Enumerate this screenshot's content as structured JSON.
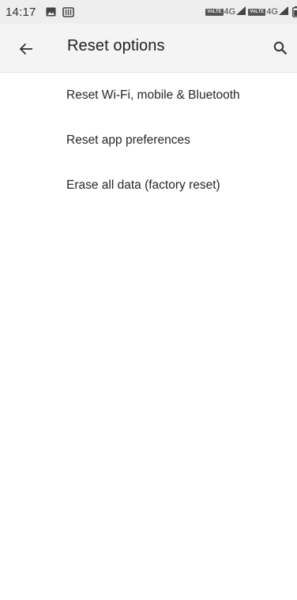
{
  "status_bar": {
    "time": "14:17",
    "icons_left": [
      "image-icon",
      "storage-icon"
    ],
    "sim1": {
      "badge": "VoLTE",
      "network": "4G"
    },
    "sim2": {
      "badge": "VoLTE",
      "network": "4G"
    },
    "icons_right": [
      "signal-icon",
      "signal-icon",
      "battery-icon"
    ]
  },
  "app_bar": {
    "title": "Reset options",
    "back_icon": "arrow-back-icon",
    "search_icon": "search-icon"
  },
  "options": [
    {
      "label": "Reset Wi-Fi, mobile & Bluetooth"
    },
    {
      "label": "Reset app preferences"
    },
    {
      "label": "Erase all data (factory reset)"
    }
  ],
  "colors": {
    "status_bar_bg": "#eeeeee",
    "app_bar_bg": "#f4f4f4",
    "text_primary": "#222222",
    "background": "#ffffff"
  }
}
